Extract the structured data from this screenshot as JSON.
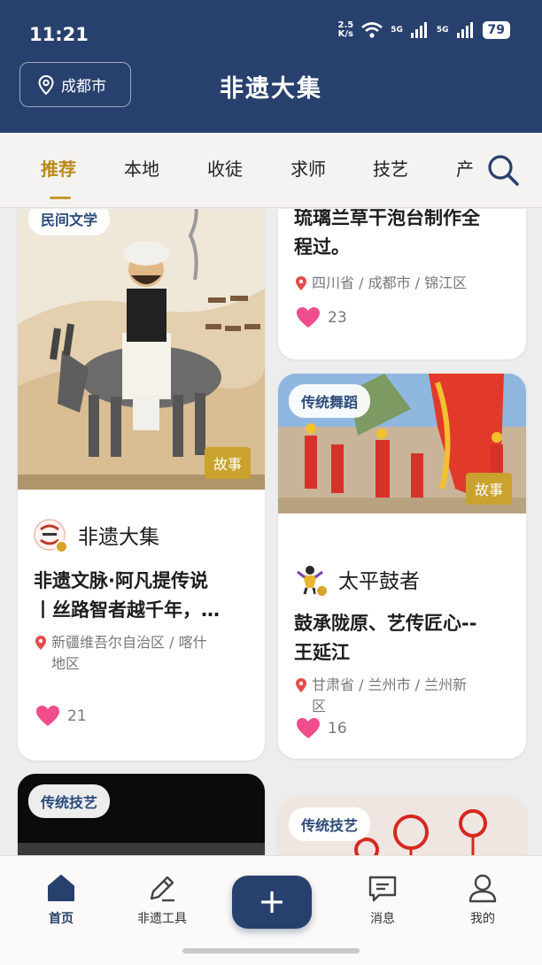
{
  "status_bar": {
    "time": "11:21",
    "speed": "2.5",
    "speed_unit": "K/s",
    "battery": "79",
    "net1": "5G",
    "net2": "5G"
  },
  "header": {
    "location": "成都市",
    "title": "非遗大集"
  },
  "tabs": [
    "推荐",
    "本地",
    "收徒",
    "求师",
    "技艺",
    "产"
  ],
  "cards": [
    {
      "category": "民间文学",
      "tag": "故事",
      "author": "非遗大集",
      "title_line1": "非遗文脉·阿凡提传说",
      "title_line2": "丨丝路智者越千年，…",
      "location_line1": "新疆维吾尔自治区 / 喀什",
      "location_line2": "地区",
      "likes": "21"
    },
    {
      "title_line1": "琉璃兰草干泡台制作全",
      "title_line2": "程过。",
      "location_line1": "四川省 / 成都市 / 锦江区",
      "likes": "23"
    },
    {
      "category": "传统舞蹈",
      "tag": "故事",
      "author": "太平鼓者",
      "title_line1": "鼓承陇原、艺传匠心--",
      "title_line2": "王延江",
      "location_line1": "甘肃省 / 兰州市 / 兰州新",
      "location_line2": "区",
      "likes": "16"
    },
    {
      "category": "传统技艺"
    },
    {
      "category": "传统技艺"
    }
  ],
  "bottom_nav": {
    "home": "首页",
    "tools": "非遗工具",
    "add": "+",
    "messages": "消息",
    "me": "我的"
  },
  "colors": {
    "primary": "#28406d",
    "accent": "#c99a2e",
    "like": "#ef4d8b",
    "tag": "#c9a32d"
  }
}
